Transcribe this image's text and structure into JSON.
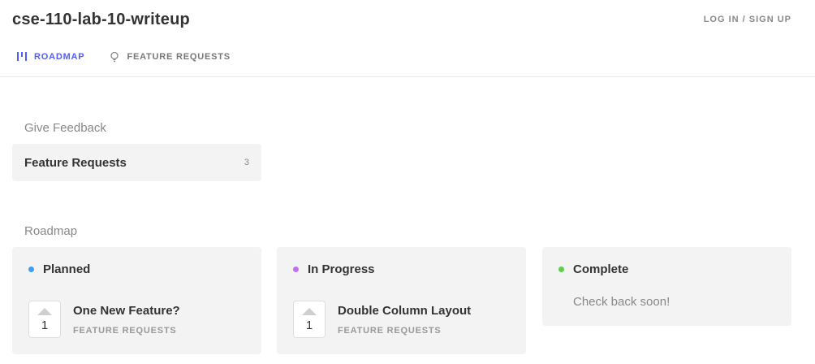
{
  "header": {
    "title": "cse-110-lab-10-writeup",
    "auth_link": "LOG IN / SIGN UP"
  },
  "nav": {
    "tabs": [
      {
        "label": "ROADMAP",
        "icon": "roadmap-icon",
        "active": true
      },
      {
        "label": "FEATURE REQUESTS",
        "icon": "lightbulb-icon",
        "active": false
      }
    ]
  },
  "feedback": {
    "heading": "Give Feedback",
    "boards": [
      {
        "name": "Feature Requests",
        "count": "3"
      }
    ]
  },
  "roadmap": {
    "heading": "Roadmap",
    "columns": [
      {
        "title": "Planned",
        "color": "#3b9ff5",
        "posts": [
          {
            "votes": "1",
            "title": "One New Feature?",
            "board": "FEATURE REQUESTS"
          }
        ]
      },
      {
        "title": "In Progress",
        "color": "#c06ef5",
        "posts": [
          {
            "votes": "1",
            "title": "Double Column Layout",
            "board": "FEATURE REQUESTS"
          }
        ]
      },
      {
        "title": "Complete",
        "color": "#5fcf4a",
        "empty_message": "Check back soon!"
      }
    ]
  },
  "colors": {
    "accent": "#525df9",
    "card_background": "#f3f3f3"
  }
}
